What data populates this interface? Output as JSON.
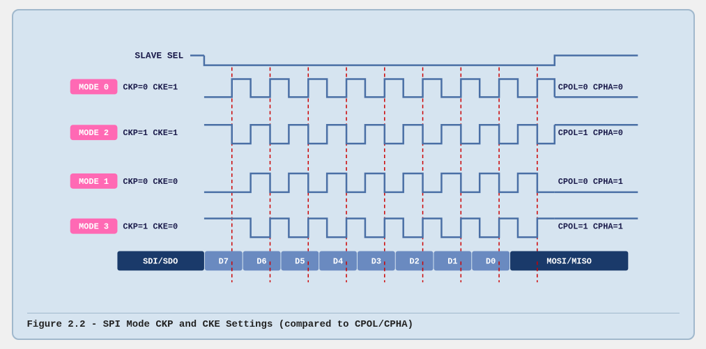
{
  "caption": "Figure 2.2 - SPI Mode CKP and CKE Settings (compared to CPOL/CPHA)",
  "diagram": {
    "slave_sel_label": "SLAVE SEL",
    "mode0": {
      "badge": "MODE 0",
      "params": "CKP=0  CKE=1",
      "right": "CPOL=0  CPHA=0"
    },
    "mode2": {
      "badge": "MODE 2",
      "params": "CKP=1  CKE=1",
      "right": "CPOL=1  CPHA=0"
    },
    "mode1": {
      "badge": "MODE 1",
      "params": "CKP=0  CKE=0",
      "right": "CPOL=0  CPHA=1"
    },
    "mode3": {
      "badge": "MODE 3",
      "params": "CKP=1  CKE=0",
      "right": "CPOL=1  CPHA=1"
    },
    "data_bits": [
      "SDI/SDO",
      "D7",
      "D6",
      "D5",
      "D4",
      "D3",
      "D2",
      "D1",
      "D0",
      "MOSI/MISO"
    ]
  }
}
